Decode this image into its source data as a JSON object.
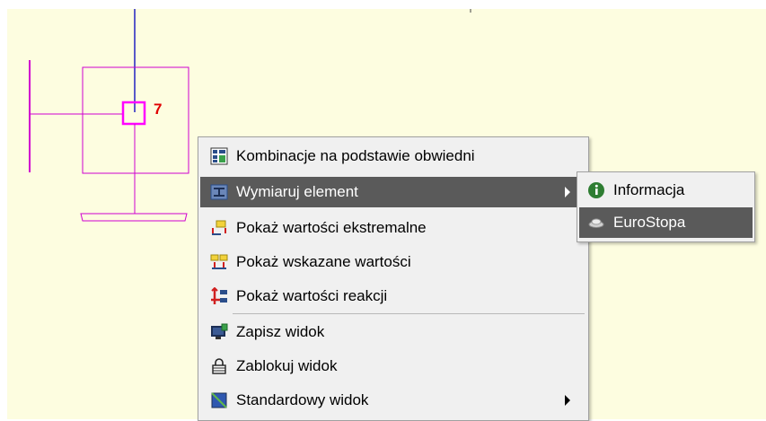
{
  "drawing": {
    "node_number": "7"
  },
  "context_menu": {
    "items": [
      {
        "label": "Kombinacje na podstawie obwiedni",
        "icon": "combinations-icon"
      },
      {
        "label": "Wymiaruj element",
        "icon": "steel-beam-icon",
        "has_submenu": true,
        "highlighted": true
      },
      {
        "label": "Pokaż wartości ekstremalne",
        "icon": "extreme-values-icon"
      },
      {
        "label": "Pokaż wskazane wartości",
        "icon": "indicated-values-icon"
      },
      {
        "label": "Pokaż wartości reakcji",
        "icon": "reactions-icon"
      },
      {
        "label": "Zapisz widok",
        "icon": "save-view-icon"
      },
      {
        "label": "Zablokuj widok",
        "icon": "lock-icon"
      },
      {
        "label": "Standardowy widok",
        "icon": "standard-view-icon",
        "has_submenu": true
      }
    ]
  },
  "submenu": {
    "items": [
      {
        "label": "Informacja",
        "icon": "info-icon"
      },
      {
        "label": "EuroStopa",
        "icon": "footing-icon",
        "highlighted": true
      }
    ]
  },
  "colors": {
    "canvas": "#fdfde0",
    "structure": "#d000d0",
    "axis": "#2020c0",
    "highlight": "#5a5a5a",
    "menu_bg": "#f0f0f0"
  }
}
